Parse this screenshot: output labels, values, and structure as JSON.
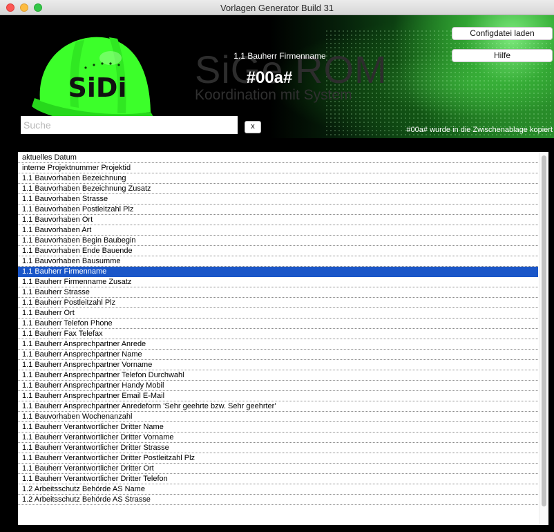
{
  "window": {
    "title": "Vorlagen Generator Build 31"
  },
  "header": {
    "logo_text": "SiDi",
    "watermark_title": "SiGe ROM",
    "watermark_subtitle": "Koordination mit System",
    "selected_label": "1.1 Bauherr Firmenname",
    "selected_value": "#00a#",
    "buttons": {
      "config": "Configdatei laden",
      "help": "Hilfe"
    },
    "search": {
      "placeholder": "Suche",
      "value": "",
      "clear_label": "x"
    },
    "status": "#00a# wurde in die Zwischenablage kopiert"
  },
  "list": {
    "selected_index": 11,
    "items": [
      "aktuelles Datum",
      "interne Projektnummer Projektid",
      "1.1 Bauvorhaben Bezeichnung",
      "1.1 Bauvorhaben Bezeichnung Zusatz",
      "1.1 Bauvorhaben Strasse",
      "1.1 Bauvorhaben Postleitzahl Plz",
      "1.1 Bauvorhaben Ort",
      "1.1 Bauvorhaben Art",
      "1.1 Bauvorhaben Begin Baubegin",
      "1.1 Bauvorhaben Ende Bauende",
      "1.1 Bauvorhaben Bausumme",
      "1.1 Bauherr Firmenname",
      "1.1 Bauherr Firmenname Zusatz",
      "1.1 Bauherr Strasse",
      "1.1 Bauherr Postleitzahl Plz",
      "1.1 Bauherr Ort",
      "1.1 Bauherr Telefon Phone",
      "1.1 Bauherr Fax Telefax",
      "1.1 Bauherr Ansprechpartner Anrede",
      "1.1 Bauherr Ansprechpartner Name",
      "1.1 Bauherr Ansprechpartner Vorname",
      "1.1 Bauherr Ansprechpartner Telefon Durchwahl",
      "1.1 Bauherr Ansprechpartner Handy Mobil",
      "1.1 Bauherr Ansprechpartner Email E-Mail",
      "1.1 Bauherr Ansprechpartner Anredeform 'Sehr geehrte bzw. Sehr geehrter'",
      "1.1 Bauvorhaben Wochenanzahl",
      "1.1 Bauherr Verantwortlicher Dritter Name",
      "1.1 Bauherr Verantwortlicher Dritter Vorname",
      "1.1 Bauherr Verantwortlicher Dritter Strasse",
      "1.1 Bauherr Verantwortlicher Dritter Postleitzahl Plz",
      "1.1 Bauherr Verantwortlicher Dritter Ort",
      "1.1 Bauherr Verantwortlicher Dritter Telefon",
      "1.2 Arbeitsschutz Behörde AS Name",
      "1.2 Arbeitsschutz Behörde AS Strasse"
    ]
  },
  "colors": {
    "selection": "#1a56c8",
    "helmet": "#3cff2a",
    "header_background": "#000000"
  },
  "icons": {
    "close": "close-icon",
    "minimize": "minimize-icon",
    "maximize": "maximize-icon",
    "logo": "helmet-logo-icon"
  }
}
